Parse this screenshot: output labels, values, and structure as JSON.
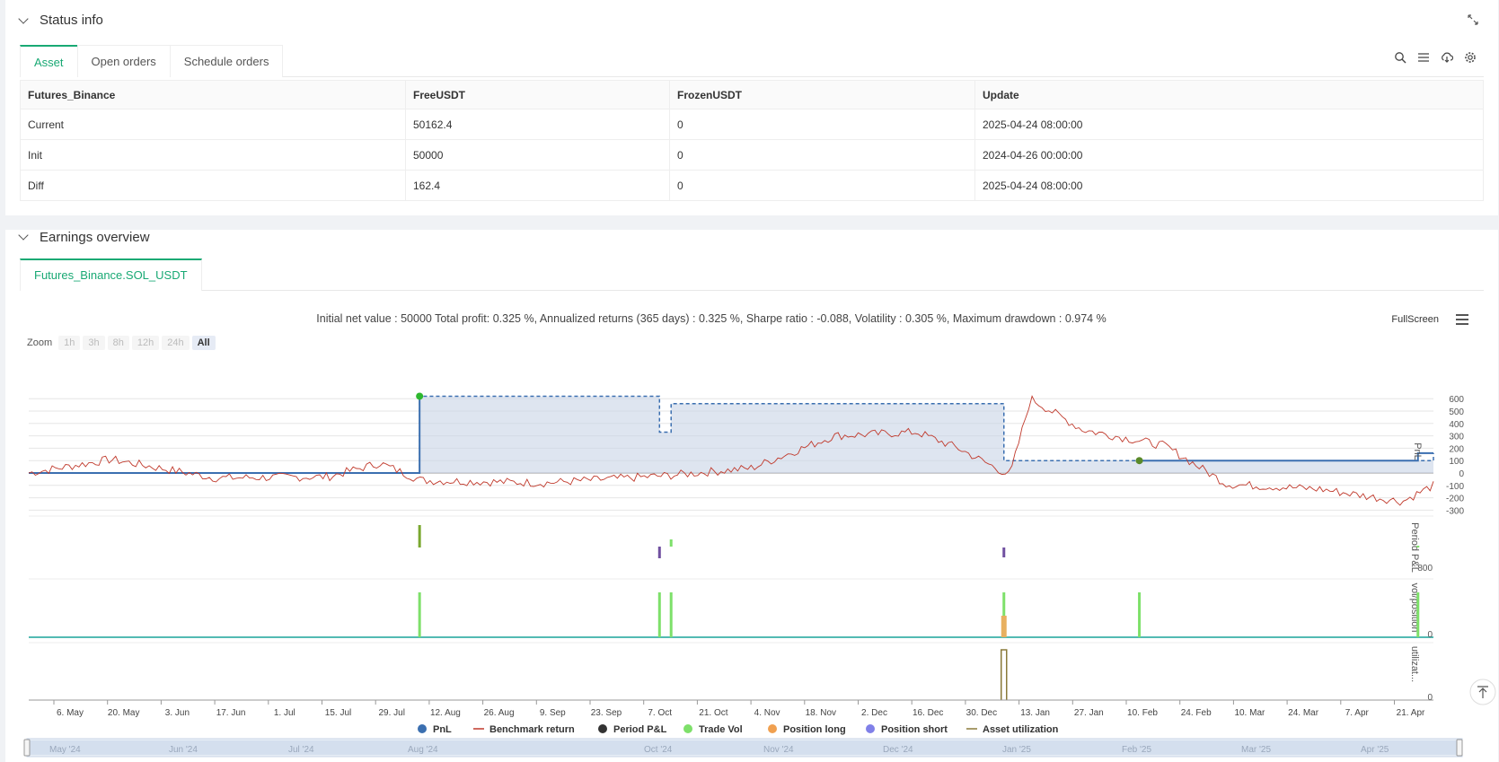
{
  "status": {
    "title": "Status info",
    "tabs": [
      "Asset",
      "Open orders",
      "Schedule orders"
    ],
    "table": {
      "headers": [
        "Futures_Binance",
        "FreeUSDT",
        "FrozenUSDT",
        "Update"
      ],
      "rows": [
        [
          "Current",
          "50162.4",
          "0",
          "2025-04-24 08:00:00"
        ],
        [
          "Init",
          "50000",
          "0",
          "2024-04-26 00:00:00"
        ],
        [
          "Diff",
          "162.4",
          "0",
          "2025-04-24 08:00:00"
        ]
      ]
    }
  },
  "earnings": {
    "title": "Earnings overview",
    "tab": "Futures_Binance.SOL_USDT",
    "summary": "Initial net value : 50000 Total profit: 0.325 %, Annualized returns (365 days) : 0.325 %, Sharpe ratio : -0.088, Volatility : 0.305 %, Maximum drawdown : 0.974 %",
    "fullscreen": "FullScreen",
    "zoom_label": "Zoom",
    "zoom_buttons": [
      "1h",
      "3h",
      "8h",
      "12h",
      "24h",
      "All"
    ]
  },
  "chart_data": {
    "type": "line",
    "x_labels": [
      "6. May",
      "20. May",
      "3. Jun",
      "17. Jun",
      "1. Jul",
      "15. Jul",
      "29. Jul",
      "12. Aug",
      "26. Aug",
      "9. Sep",
      "23. Sep",
      "7. Oct",
      "21. Oct",
      "4. Nov",
      "18. Nov",
      "2. Dec",
      "16. Dec",
      "30. Dec",
      "13. Jan",
      "27. Jan",
      "10. Feb",
      "24. Feb",
      "10. Mar",
      "24. Mar",
      "7. Apr",
      "21. Apr"
    ],
    "navigator_labels": [
      "May '24",
      "Jun '24",
      "Jul '24",
      "Aug '24",
      "Oct '24",
      "Nov '24",
      "Dec '24",
      "Jan '25",
      "Feb '25",
      "Mar '25",
      "Apr '25"
    ],
    "pnl_axis_ticks": [
      "600",
      "500",
      "400",
      "300",
      "200",
      "100",
      "0",
      "-100",
      "-200",
      "-300"
    ],
    "pane_labels": [
      "PnL",
      "Period P&L",
      "vol/position",
      "utilizat..."
    ],
    "period_axis_label": "-800",
    "vol_axis_label": "0",
    "util_axis_label": "0",
    "legend": [
      {
        "name": "PnL",
        "color": "#3b6fb0"
      },
      {
        "name": "Benchmark return",
        "color": "#c0392b"
      },
      {
        "name": "Period P&L",
        "color": "#333333"
      },
      {
        "name": "Trade Vol",
        "color": "#7ee06a"
      },
      {
        "name": "Position long",
        "color": "#f0a050"
      },
      {
        "name": "Position short",
        "color": "#8080e8"
      },
      {
        "name": "Asset utilization",
        "color": "#8a7a3a"
      }
    ],
    "pnl_steps": [
      {
        "date": "2024-04-26",
        "value": 0
      },
      {
        "date": "2024-08-05",
        "value": 620
      },
      {
        "date": "2024-10-06",
        "value": 330
      },
      {
        "date": "2024-10-09",
        "value": 560
      },
      {
        "date": "2025-01-03",
        "value": 100
      },
      {
        "date": "2025-04-24",
        "value": 160
      }
    ],
    "trade_dates": [
      "2024-08-05",
      "2024-10-06",
      "2024-10-09",
      "2025-01-03",
      "2025-02-07",
      "2025-04-20"
    ]
  }
}
